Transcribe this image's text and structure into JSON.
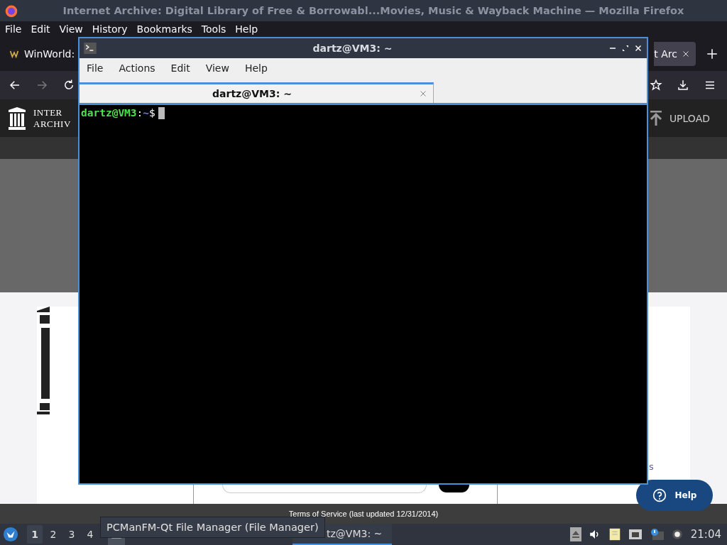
{
  "firefox": {
    "title": "Internet Archive: Digital Library of Free & Borrowabl...Movies, Music & Wayback Machine — Mozilla Firefox",
    "menu": [
      "File",
      "Edit",
      "View",
      "History",
      "Bookmarks",
      "Tools",
      "Help"
    ],
    "tabs": [
      {
        "label": "WinWorld:",
        "selected": false
      },
      {
        "label": "t Arc",
        "selected": true
      }
    ],
    "page": {
      "logo_lines": [
        "INTER",
        "ARCHIV"
      ],
      "upload": "UPLOAD",
      "fragment": "s",
      "help": "Help",
      "footer": "Terms of Service (last updated 12/31/2014)"
    }
  },
  "terminal": {
    "title": "dartz@VM3: ~",
    "menu": [
      "File",
      "Actions",
      "Edit",
      "View",
      "Help"
    ],
    "tabs": [
      {
        "label": "dartz@VM3: ~",
        "selected": true
      }
    ],
    "prompt": {
      "user": "dartz@VM3",
      "separator": ":",
      "path": "~",
      "symbol": "$"
    }
  },
  "taskbar": {
    "workspaces": [
      {
        "label": "1",
        "selected": true
      },
      {
        "label": "2",
        "selected": false
      },
      {
        "label": "3",
        "selected": false
      },
      {
        "label": "4",
        "selected": false
      }
    ],
    "task": {
      "label": "tz@VM3: ~",
      "selected": true
    },
    "clock": "21:04",
    "tooltip": "PCManFM-Qt File Manager (File Manager)"
  }
}
